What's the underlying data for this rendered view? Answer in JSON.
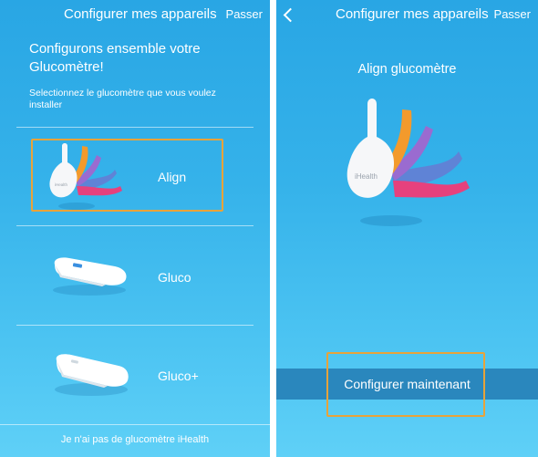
{
  "left_screen": {
    "nav": {
      "title": "Configurer mes appareils",
      "skip": "Passer"
    },
    "intro": {
      "title": "Configurons ensemble votre Glucomètre!",
      "subtitle": "Selectionnez le glucomètre que vous voulez installer"
    },
    "devices": [
      {
        "label": "Align",
        "icon": "align-glucometer-image",
        "brand": "iHealth"
      },
      {
        "label": "Gluco",
        "icon": "gluco-device-image"
      },
      {
        "label": "Gluco+",
        "icon": "gluco-plus-device-image"
      }
    ],
    "footer_link": "Je n'ai pas de glucomètre iHealth"
  },
  "right_screen": {
    "nav": {
      "title": "Configurer mes appareils",
      "skip": "Passer",
      "back_icon": "chevron-left-icon"
    },
    "hero_title": "Align glucomètre",
    "device_brand": "iHealth",
    "cta_label": "Configurer maintenant"
  },
  "colors": {
    "background_top": "#29a6e4",
    "background_bottom": "#5fd0f7",
    "cta_band": "#2a87bd",
    "highlight": "#e8a33a",
    "strip_orange": "#f39a2c",
    "strip_blue": "#5f83d6",
    "strip_purple": "#9a6bd0",
    "strip_pink": "#e6417d"
  }
}
